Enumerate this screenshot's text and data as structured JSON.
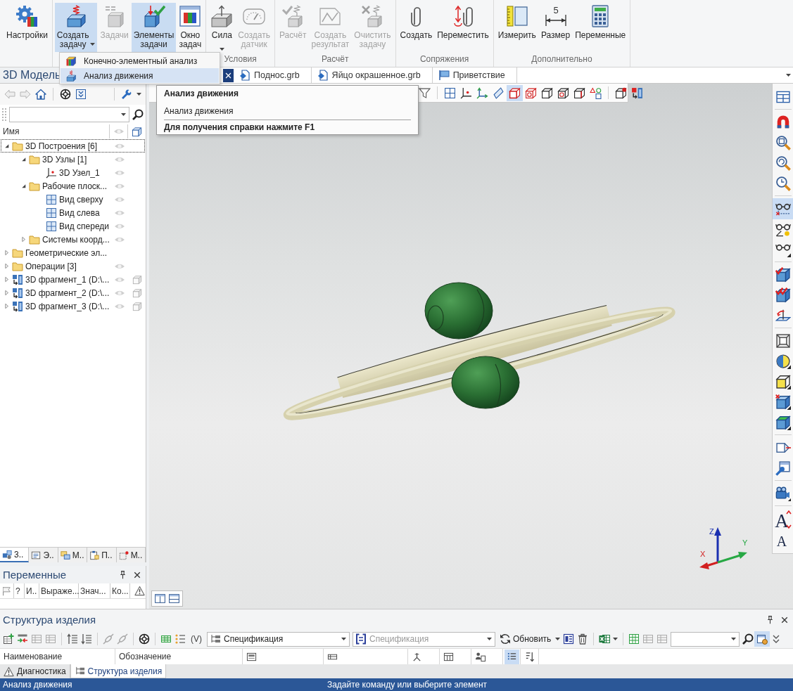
{
  "ribbon": {
    "groups": [
      {
        "buttons": [
          {
            "label": "Настройки",
            "kind": "gear",
            "selected": false,
            "disabled": false
          }
        ]
      },
      {
        "buttons": [
          {
            "label": "Создать задачу",
            "kind": "task-create",
            "selected": true,
            "disabled": false,
            "dropdown": true
          },
          {
            "label": "Задачи",
            "kind": "tasks",
            "selected": false,
            "disabled": true
          },
          {
            "label": "Элементы задачи",
            "kind": "task-elements",
            "selected": true,
            "disabled": false
          },
          {
            "label": "Окно задач",
            "kind": "task-window",
            "selected": false,
            "disabled": false
          }
        ]
      },
      {
        "label": "Условия",
        "buttons": [
          {
            "label": "Сила",
            "kind": "force",
            "selected": false,
            "disabled": false,
            "dropdown": true
          },
          {
            "label": "Создать датчик",
            "kind": "sensor",
            "selected": false,
            "disabled": true
          }
        ]
      },
      {
        "label": "Расчёт",
        "buttons": [
          {
            "label": "Расчёт",
            "kind": "calc",
            "selected": false,
            "disabled": true
          },
          {
            "label": "Создать результат",
            "kind": "result",
            "selected": false,
            "disabled": true
          },
          {
            "label": "Очистить задачу",
            "kind": "clear",
            "selected": false,
            "disabled": true
          }
        ]
      },
      {
        "label": "Сопряжения",
        "buttons": [
          {
            "label": "Создать",
            "kind": "mate",
            "selected": false,
            "disabled": false
          },
          {
            "label": "Переместить",
            "kind": "mate-move",
            "selected": false,
            "disabled": false
          }
        ]
      },
      {
        "label": "Дополнительно",
        "buttons": [
          {
            "label": "Измерить",
            "kind": "measure",
            "selected": false,
            "disabled": false
          },
          {
            "label": "Размер",
            "kind": "dimension",
            "icon_text": "5",
            "selected": false,
            "disabled": false
          },
          {
            "label": "Переменные",
            "kind": "variables",
            "selected": false,
            "disabled": false
          }
        ]
      }
    ]
  },
  "menu": {
    "items": [
      {
        "label": "Конечно-элементный анализ",
        "kind": "fea",
        "selected": false
      },
      {
        "label": "Анализ движения",
        "kind": "motion",
        "selected": true
      }
    ]
  },
  "tooltip": {
    "title": "Анализ движения",
    "description": "Анализ движения",
    "help": "Для получения справки нажмите F1"
  },
  "model_panel": {
    "title": "3D Модель",
    "toolbar": [
      {
        "kind": "back",
        "disabled": true
      },
      {
        "kind": "forward",
        "disabled": true
      },
      {
        "kind": "home"
      },
      {
        "kind": "sep"
      },
      {
        "kind": "target"
      },
      {
        "kind": "collapse"
      },
      {
        "kind": "sep"
      },
      {
        "kind": "wrench"
      }
    ],
    "column": "Имя",
    "tree": [
      {
        "label": "3D Построения [6]",
        "kind": "folder",
        "expanded": true,
        "selected": true,
        "eye": true,
        "children": [
          {
            "label": "3D Узлы [1]",
            "kind": "folder",
            "expanded": true,
            "selected": false,
            "eye": true,
            "children": [
              {
                "label": "3D Узел_1",
                "kind": "node",
                "selected": false,
                "eye": true
              }
            ]
          },
          {
            "label": "Рабочие плоск...",
            "kind": "folder",
            "expanded": true,
            "selected": false,
            "eye": true,
            "children": [
              {
                "label": "Вид сверху",
                "kind": "plane",
                "selected": false,
                "eye": true
              },
              {
                "label": "Вид слева",
                "kind": "plane",
                "selected": false,
                "eye": true
              },
              {
                "label": "Вид спереди",
                "kind": "plane",
                "selected": false,
                "eye": true
              }
            ]
          },
          {
            "label": "Системы коорд...",
            "kind": "folder",
            "expanded": false,
            "selected": false,
            "eye": true
          }
        ]
      },
      {
        "label": "Геометрические эл...",
        "kind": "folder",
        "expanded": false,
        "selected": false,
        "eye": false
      },
      {
        "label": "Операции [3]",
        "kind": "folder",
        "expanded": false,
        "selected": false,
        "eye": true
      },
      {
        "label": "3D фрагмент_1 (D:\\...",
        "kind": "fragment",
        "expanded": false,
        "selected": false,
        "eye": true,
        "component": true
      },
      {
        "label": "3D фрагмент_2 (D:\\...",
        "kind": "fragment",
        "expanded": false,
        "selected": false,
        "eye": true,
        "component": true
      },
      {
        "label": "3D фрагмент_3 (D:\\...",
        "kind": "fragment",
        "expanded": false,
        "selected": false,
        "eye": true,
        "component": true
      }
    ],
    "tabs": [
      {
        "label": "3..",
        "kind": "tab-parts",
        "selected": true
      },
      {
        "label": "Э..",
        "kind": "tab-list",
        "selected": false
      },
      {
        "label": "М..",
        "kind": "tab-layers",
        "selected": false
      },
      {
        "label": "П..",
        "kind": "tab-props",
        "selected": false
      },
      {
        "label": "М..",
        "kind": "tab-marker",
        "selected": false
      }
    ]
  },
  "document_tabs": [
    {
      "label": "Поднос.grb",
      "kind": "document"
    },
    {
      "label": "Яйцо окрашенное.grb",
      "kind": "document"
    },
    {
      "label": "Приветствие",
      "kind": "welcome"
    }
  ],
  "viewport": {
    "toolbar": [
      {
        "kind": "funnel"
      },
      {
        "kind": "sep"
      },
      {
        "kind": "grid"
      },
      {
        "kind": "node"
      },
      {
        "kind": "axes"
      },
      {
        "kind": "plane-sheet"
      },
      {
        "kind": "cube-red",
        "selected": true
      },
      {
        "kind": "cube-red-hole",
        "selected": false
      },
      {
        "kind": "cube-black",
        "selected": false
      },
      {
        "kind": "cube-black-hole",
        "selected": false
      },
      {
        "kind": "cube-edge",
        "selected": false
      },
      {
        "kind": "shapes",
        "selected": false
      },
      {
        "kind": "sep"
      },
      {
        "kind": "cube-corner"
      },
      {
        "kind": "fragment-red"
      }
    ],
    "side_toolbar": [
      {
        "kind": "layout"
      },
      {
        "kind": "sep"
      },
      {
        "kind": "magnet"
      },
      {
        "kind": "zoom-frame"
      },
      {
        "kind": "zoom-rotate"
      },
      {
        "kind": "zoom-clock"
      },
      {
        "kind": "sep"
      },
      {
        "kind": "glasses-dash",
        "selected": true
      },
      {
        "kind": "glasses-angle",
        "selected": false
      },
      {
        "kind": "glasses-corner",
        "selected": false
      },
      {
        "kind": "sep"
      },
      {
        "kind": "tick-cube"
      },
      {
        "kind": "tick2-cube"
      },
      {
        "kind": "rotate-plane"
      },
      {
        "kind": "sep"
      },
      {
        "kind": "cube-frame"
      },
      {
        "kind": "sphere-half"
      },
      {
        "kind": "cube-face"
      },
      {
        "kind": "cube-cross"
      },
      {
        "kind": "cube-green"
      },
      {
        "kind": "sep"
      },
      {
        "kind": "projection"
      },
      {
        "kind": "window-wrench"
      },
      {
        "kind": "sep"
      },
      {
        "kind": "camera"
      },
      {
        "kind": "sep"
      },
      {
        "kind": "font-up",
        "text": "A"
      },
      {
        "kind": "font-down",
        "text": "A"
      }
    ],
    "axes": {
      "x": "X",
      "y": "Y",
      "z": "Z"
    }
  },
  "variables_panel": {
    "title": "Переменные",
    "columns": [
      "?",
      "И..",
      "Выраже...",
      "Знач...",
      "Ко..."
    ]
  },
  "structure_panel": {
    "title": "Структура изделия",
    "toolbar": [
      {
        "kind": "table-plus"
      },
      {
        "kind": "arrows-table"
      },
      {
        "kind": "table-gray"
      },
      {
        "kind": "table-gray"
      },
      {
        "kind": "sep"
      },
      {
        "kind": "sort-up"
      },
      {
        "kind": "sort-down"
      },
      {
        "kind": "sep"
      },
      {
        "kind": "link"
      },
      {
        "kind": "link"
      },
      {
        "kind": "sep"
      },
      {
        "kind": "target"
      },
      {
        "kind": "sep"
      },
      {
        "kind": "grid-green"
      },
      {
        "kind": "numbering"
      },
      {
        "kind": "text",
        "text": "(V)"
      },
      {
        "kind": "tree-combo",
        "text": "Спецификация",
        "disabled": false
      },
      {
        "kind": "bracket-combo",
        "text": "Спецификация",
        "disabled": true
      },
      {
        "kind": "refresh-button",
        "text": "Обновить"
      },
      {
        "kind": "caret"
      },
      {
        "kind": "report"
      },
      {
        "kind": "trash"
      },
      {
        "kind": "sep"
      },
      {
        "kind": "spreadsheet"
      },
      {
        "kind": "caret"
      },
      {
        "kind": "sep"
      },
      {
        "kind": "table-green"
      },
      {
        "kind": "table-gray"
      },
      {
        "kind": "table-gray"
      },
      {
        "kind": "combo"
      },
      {
        "kind": "search"
      },
      {
        "kind": "settings-panel",
        "selected": true
      },
      {
        "kind": "chevron"
      }
    ],
    "columns": [
      {
        "label": "Наименование"
      },
      {
        "label": "Обозначение"
      },
      {
        "kind": "form"
      },
      {
        "kind": "row"
      },
      {
        "kind": "tripod"
      },
      {
        "kind": "table"
      },
      {
        "kind": "person-table"
      },
      {
        "kind": "list",
        "selected": true
      },
      {
        "kind": "sort"
      }
    ]
  },
  "bottom_tabs": [
    {
      "label": "Диагностика",
      "kind": "warning",
      "selected": false
    },
    {
      "label": "Структура изделия",
      "kind": "structure",
      "selected": true
    }
  ],
  "status_bar": {
    "left": "Анализ движения",
    "center": "Задайте команду или выберите элемент"
  }
}
